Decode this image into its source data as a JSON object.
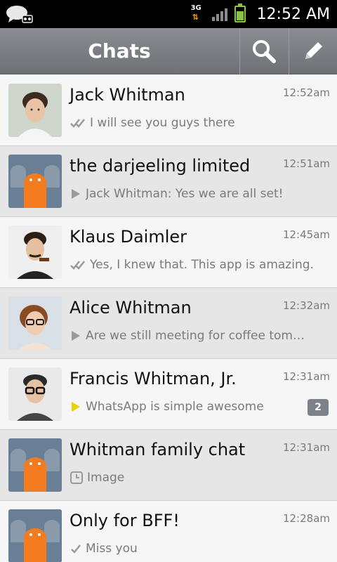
{
  "status_bar": {
    "network": "3G",
    "time": "12:52 AM"
  },
  "action_bar": {
    "title": "Chats",
    "search_icon": "search-icon",
    "compose_icon": "compose-icon"
  },
  "colors": {
    "action_bar": "#7b7e82",
    "badge": "#7d8288",
    "play_gray": "#9a9a9a",
    "play_yellow": "#e6d400",
    "battery": "#8ac540"
  },
  "chats": [
    {
      "name": "Jack Whitman",
      "time": "12:52am",
      "status_icon": "double-check-icon",
      "preview": "I will see you guys there"
    },
    {
      "name": "the darjeeling limited",
      "time": "12:51am",
      "status_icon": "play-icon",
      "preview": "Jack Whitman: Yes we are all set!"
    },
    {
      "name": "Klaus Daimler",
      "time": "12:45am",
      "status_icon": "double-check-icon",
      "preview": "Yes, I knew that. This app is amazing."
    },
    {
      "name": "Alice Whitman",
      "time": "12:32am",
      "status_icon": "play-icon",
      "preview": "Are we still meeting for coffee tom…"
    },
    {
      "name": "Francis Whitman, Jr.",
      "time": "12:31am",
      "status_icon": "play-yellow-icon",
      "preview": "WhatsApp is simple awesome",
      "unread": "2"
    },
    {
      "name": "Whitman family chat",
      "time": "12:31am",
      "status_icon": "clock-icon",
      "preview": "Image"
    },
    {
      "name": "Only for BFF!",
      "time": "12:28am",
      "status_icon": "check-icon",
      "preview": "Miss you"
    }
  ]
}
